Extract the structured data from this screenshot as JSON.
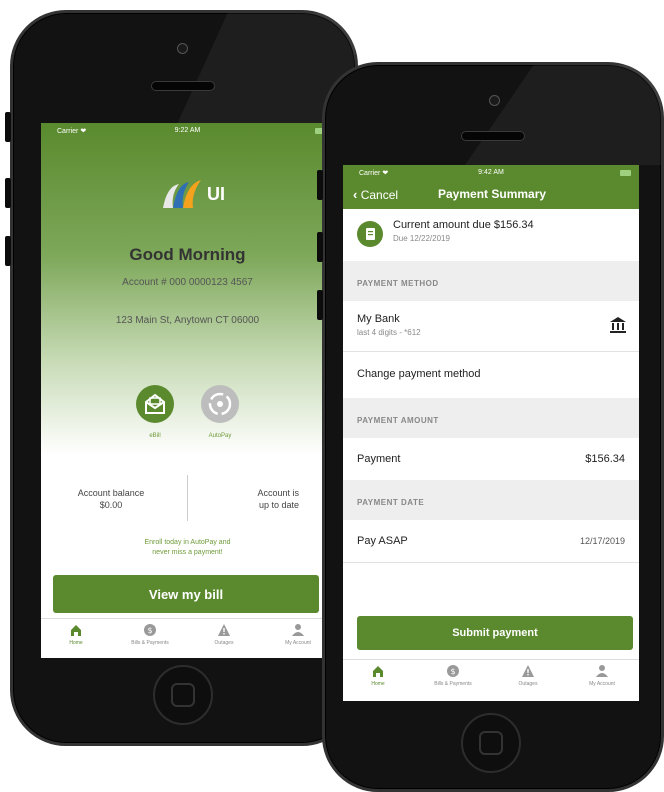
{
  "status_bar": {
    "carrier": "Carrier ❤",
    "time_left": "9:22 AM",
    "time_right": "9:42 AM"
  },
  "home": {
    "logo_text": "UI",
    "greeting": "Good Morning",
    "account_number": "Account # 000 0000123 4567",
    "address": "123 Main St, Anytown CT 06000",
    "ebill_label": "eBill",
    "autopay_label": "AutoPay",
    "balance_line1": "Account balance",
    "balance_line2": "$0.00",
    "status_line1": "Account is",
    "status_line2": "up to date",
    "promo_line1": "Enroll today in AutoPay and",
    "promo_line2": "never miss a payment!",
    "view_bill_button": "View my bill"
  },
  "tabs": [
    {
      "label": "Home",
      "icon": "home-icon"
    },
    {
      "label": "Bills & Payments",
      "icon": "dollar-icon"
    },
    {
      "label": "Outages",
      "icon": "warning-icon"
    },
    {
      "label": "My Account",
      "icon": "person-icon"
    }
  ],
  "payment": {
    "back_label": "Cancel",
    "title": "Payment Summary",
    "current_due": "Current amount due $156.34",
    "due_date": "Due 12/22/2019",
    "method_header": "PAYMENT METHOD",
    "bank_name": "My Bank",
    "bank_digits": "last 4 digits - *612",
    "change_method": "Change payment method",
    "amount_header": "PAYMENT AMOUNT",
    "payment_label": "Payment",
    "payment_value": "$156.34",
    "date_header": "PAYMENT DATE",
    "pay_label": "Pay ASAP",
    "pay_date": "12/17/2019",
    "submit_button": "Submit payment"
  },
  "colors": {
    "brand_green": "#5b8a2e",
    "phone_body": "#121212"
  }
}
